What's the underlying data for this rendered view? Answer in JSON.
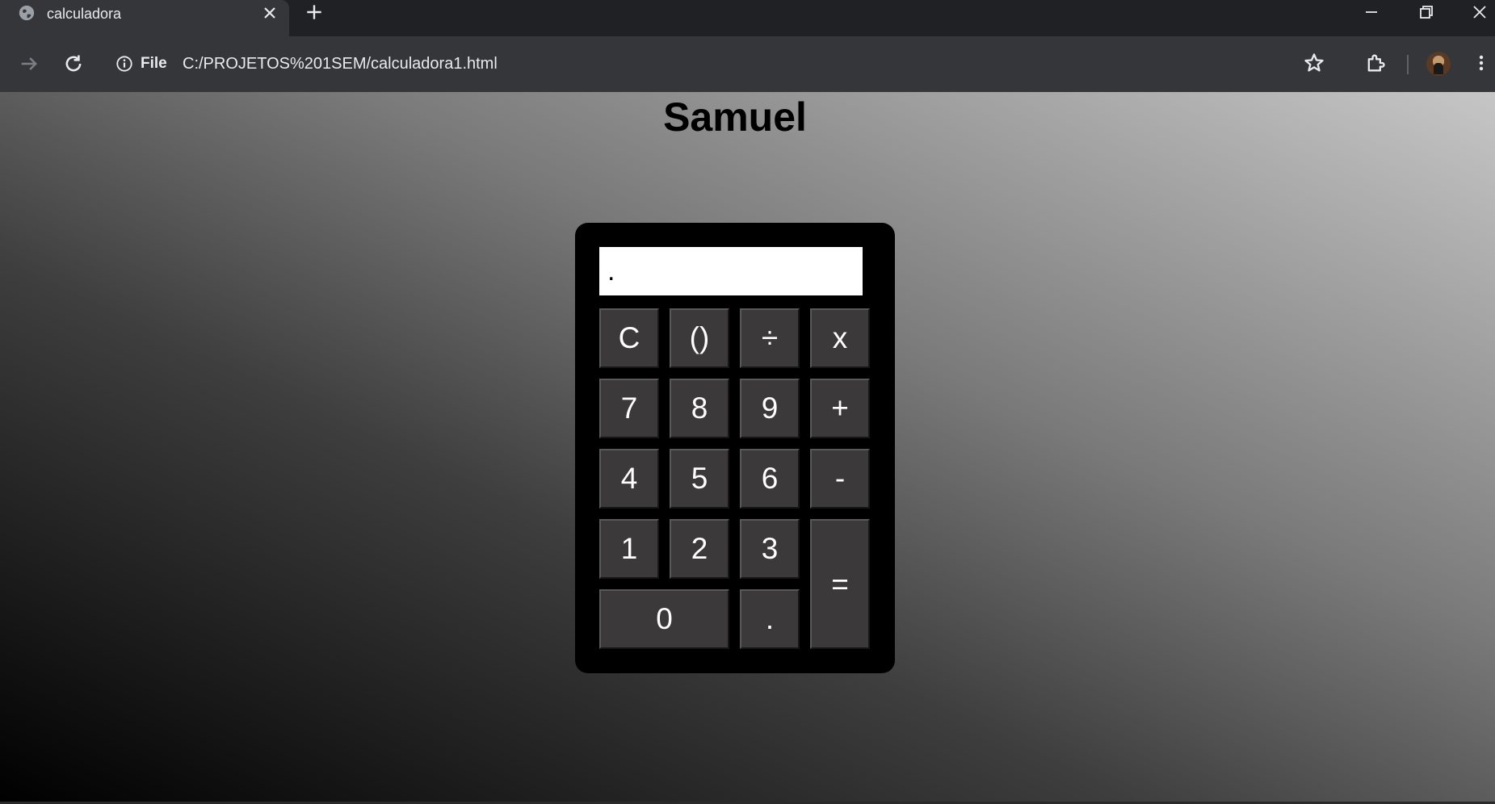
{
  "browser": {
    "tab_title": "calculadora",
    "site_info_label": "File",
    "url": "C:/PROJETOS%201SEM/calculadora1.html"
  },
  "page": {
    "heading": "Samuel"
  },
  "calculator": {
    "display_value": ".",
    "keys": {
      "clear": "C",
      "parens": "()",
      "divide": "÷",
      "multiply": "x",
      "seven": "7",
      "eight": "8",
      "nine": "9",
      "plus": "+",
      "four": "4",
      "five": "5",
      "six": "6",
      "minus": "-",
      "one": "1",
      "two": "2",
      "three": "3",
      "equals": "=",
      "zero": "0",
      "decimal": "."
    }
  },
  "colors": {
    "page_background": "#202124",
    "toolbar": "#35363a",
    "calculator_body": "#000000",
    "key_face": "#3b3939",
    "key_text": "#ffffff"
  },
  "icons": [
    "globe-icon",
    "close-icon",
    "plus-icon",
    "minimize-icon",
    "restore-icon",
    "window-close-icon",
    "forward-arrow-icon",
    "reload-icon",
    "info-icon",
    "star-icon",
    "extensions-icon",
    "avatar",
    "more-vert-icon"
  ]
}
